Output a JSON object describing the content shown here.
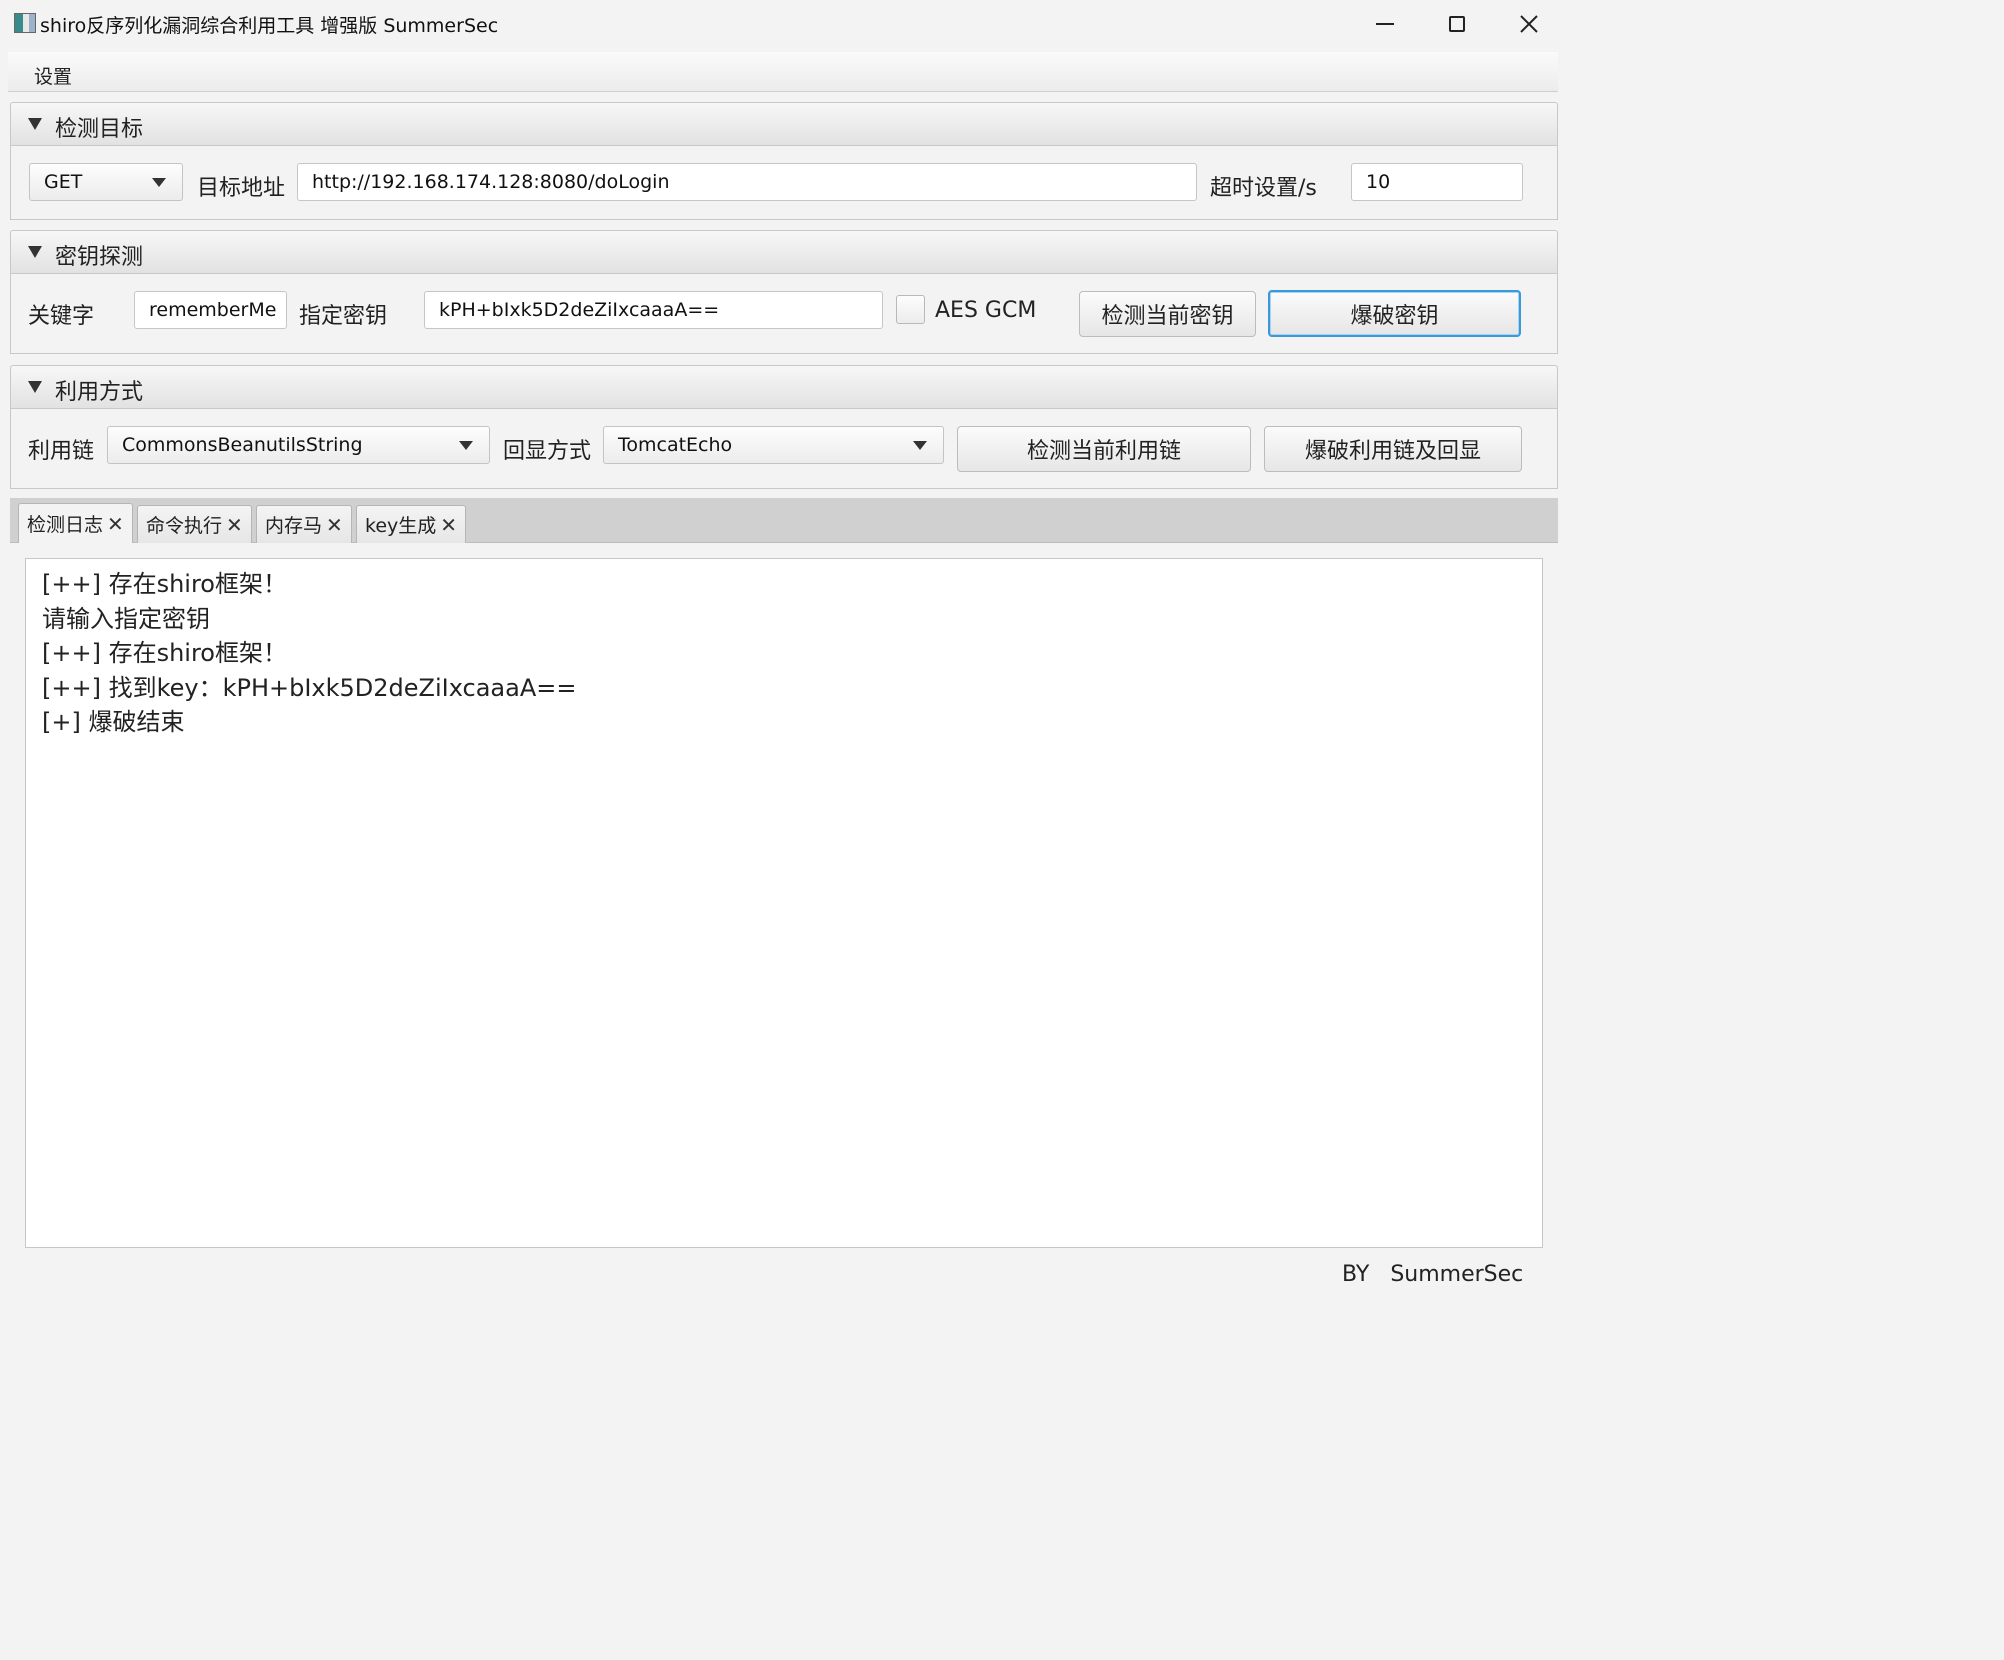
{
  "window": {
    "title": "shiro反序列化漏洞综合利用工具 增强版 SummerSec"
  },
  "menu": {
    "settings": "设置"
  },
  "target_section": {
    "title": "检测目标",
    "method": "GET",
    "url_label": "目标地址",
    "url": "http://192.168.174.128:8080/doLogin",
    "timeout_label": "超时设置/s",
    "timeout": "10"
  },
  "key_section": {
    "title": "密钥探测",
    "keyword_label": "关键字",
    "keyword": "rememberMe",
    "key_label": "指定密钥",
    "key": "kPH+bIxk5D2deZiIxcaaaA==",
    "aes_gcm_label": "AES GCM",
    "aes_gcm_checked": false,
    "check_key_button": "检测当前密钥",
    "brute_key_button": "爆破密钥"
  },
  "exploit_section": {
    "title": "利用方式",
    "chain_label": "利用链",
    "chain": "CommonsBeanutilsString",
    "echo_label": "回显方式",
    "echo": "TomcatEcho",
    "check_chain_button": "检测当前利用链",
    "brute_chain_button": "爆破利用链及回显"
  },
  "tabs": [
    {
      "label": "检测日志",
      "active": true
    },
    {
      "label": "命令执行",
      "active": false
    },
    {
      "label": "内存马",
      "active": false
    },
    {
      "label": "key生成",
      "active": false
    }
  ],
  "log": [
    "[++] 存在shiro框架！",
    "请输入指定密钥",
    "[++] 存在shiro框架！",
    "[++] 找到key：kPH+bIxk5D2deZiIxcaaaA==",
    "[+] 爆破结束"
  ],
  "footer": {
    "by": "BY",
    "author": "SummerSec"
  }
}
